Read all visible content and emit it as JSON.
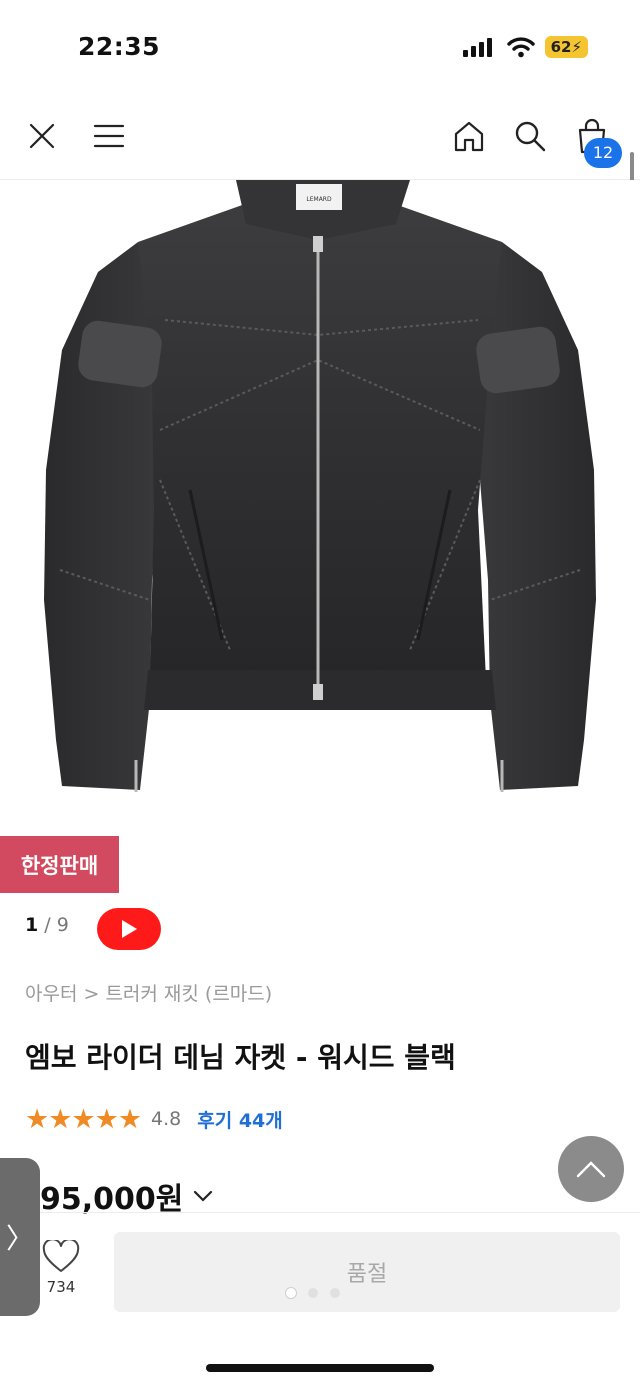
{
  "status_bar": {
    "time": "22:35",
    "battery": "62"
  },
  "nav": {
    "icons": [
      "close-icon",
      "menu-icon",
      "home-icon",
      "search-icon",
      "shopping-bag-icon"
    ],
    "cart_count": "12"
  },
  "product": {
    "badge": "한정판매",
    "image_index": "1",
    "image_total": "9",
    "image_separator": "/",
    "breadcrumb": "아우터 > 트러커 재킷 (르마드)",
    "title": "엠보 라이더 데님 자켓 - 워시드 블랙",
    "rating": "4.8",
    "reviews": "후기 44개",
    "price": "95,000원",
    "likes": "734",
    "buy_button": "품절",
    "jacket_label": "LEMARD"
  },
  "side_tab": {
    "label": "〉"
  },
  "colors": {
    "badge": "#d24a5f",
    "link": "#1f6fd6",
    "star": "#f08a24",
    "youtube": "#ff1a1a",
    "cart_badge": "#1a73e8"
  }
}
